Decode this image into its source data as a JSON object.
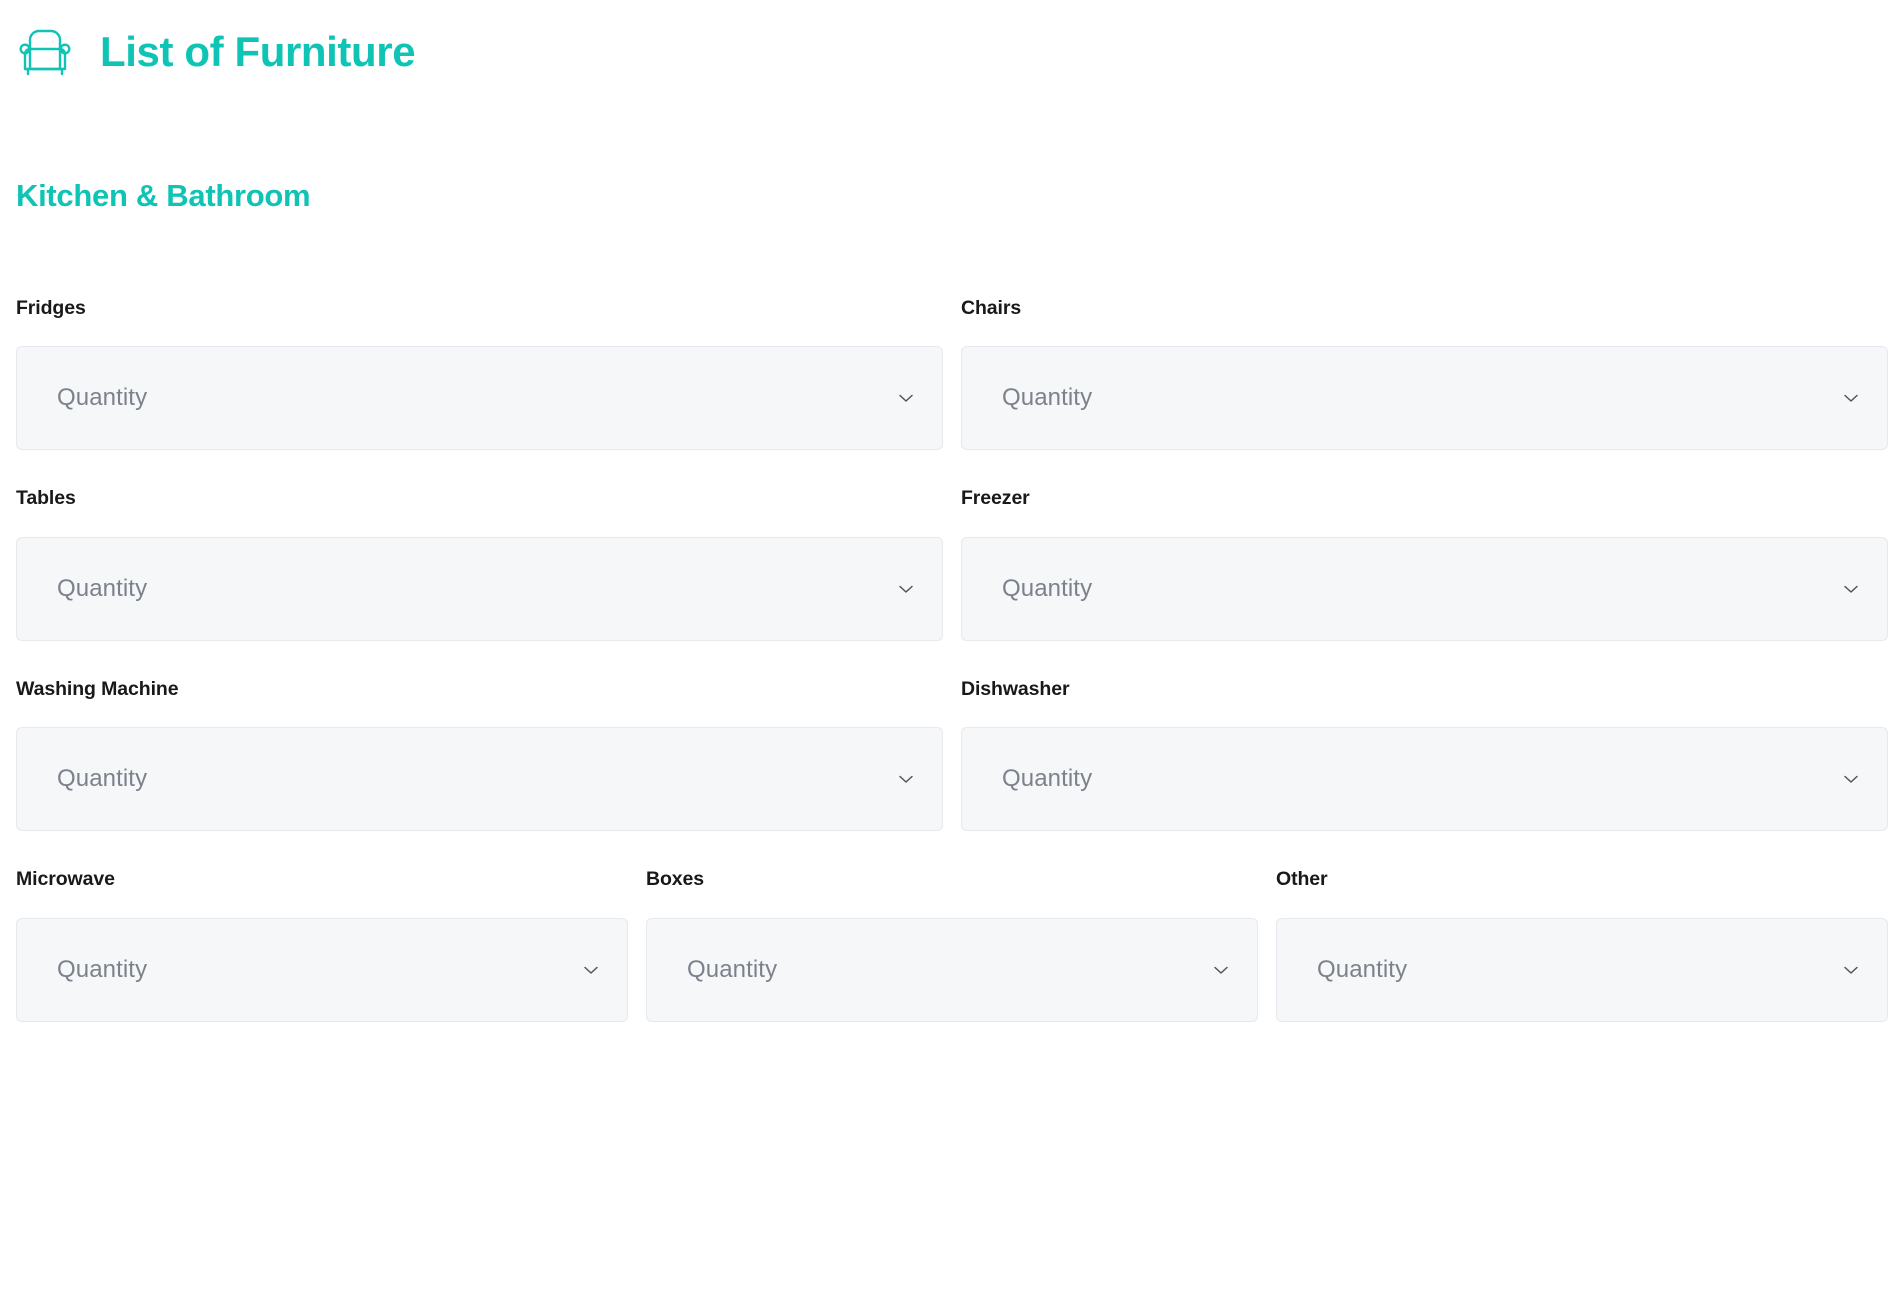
{
  "theme": {
    "accent": "#10c4b5",
    "label_color": "#191919",
    "field_bg": "#f6f7f9",
    "field_border": "#e7e9ee",
    "placeholder_color": "#7c828b",
    "page_bg": "#ffffff"
  },
  "header": {
    "icon": "armchair-icon",
    "title": "List of Furniture"
  },
  "section": {
    "title": "Kitchen & Bathroom"
  },
  "placeholder": "Quantity",
  "chevron_icon": "chevron-down-icon",
  "rows": [
    {
      "columns": 2,
      "fields": [
        {
          "label": "Fridges",
          "value": "Quantity",
          "placeholder": "Quantity"
        },
        {
          "label": "Chairs",
          "value": "Quantity",
          "placeholder": "Quantity"
        }
      ]
    },
    {
      "columns": 2,
      "fields": [
        {
          "label": "Tables",
          "value": "Quantity",
          "placeholder": "Quantity"
        },
        {
          "label": "Freezer",
          "value": "Quantity",
          "placeholder": "Quantity"
        }
      ]
    },
    {
      "columns": 2,
      "fields": [
        {
          "label": "Washing Machine",
          "value": "Quantity",
          "placeholder": "Quantity"
        },
        {
          "label": "Dishwasher",
          "value": "Quantity",
          "placeholder": "Quantity"
        }
      ]
    },
    {
      "columns": 3,
      "fields": [
        {
          "label": "Microwave",
          "value": "Quantity",
          "placeholder": "Quantity"
        },
        {
          "label": "Boxes",
          "value": "Quantity",
          "placeholder": "Quantity"
        },
        {
          "label": "Other",
          "value": "Quantity",
          "placeholder": "Quantity"
        }
      ]
    }
  ]
}
